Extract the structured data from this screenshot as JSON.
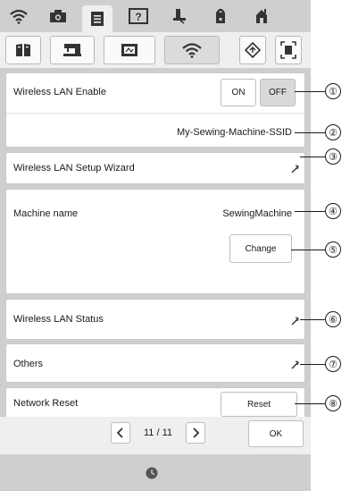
{
  "top_icons": [
    "wifi-icon",
    "camera-icon",
    "document-icon",
    "help-icon",
    "sewing-icon",
    "home-icon",
    "machine-icon"
  ],
  "tab_icons": [
    "book-icon",
    "machine-tab-icon",
    "embroidery-icon",
    "wifi-tab-icon",
    "reset-settings-icon",
    "screen-capture-icon"
  ],
  "rows": {
    "wlan_enable": {
      "label": "Wireless LAN Enable",
      "on_label": "ON",
      "off_label": "OFF",
      "state": "OFF"
    },
    "ssid": {
      "value": "My-Sewing-Machine-SSID"
    },
    "setup_wizard": {
      "label": "Wireless LAN Setup Wizard"
    },
    "machine_name": {
      "label": "Machine name",
      "value": "SewingMachine",
      "change_label": "Change"
    },
    "status": {
      "label": "Wireless LAN Status"
    },
    "others": {
      "label": "Others"
    },
    "network_reset": {
      "label": "Network Reset",
      "reset_label": "Reset"
    }
  },
  "pager": {
    "page_text": "11 / 11",
    "ok_label": "OK"
  },
  "callouts": [
    "①",
    "②",
    "③",
    "④",
    "⑤",
    "⑥",
    "⑦",
    "⑧"
  ],
  "colors": {
    "screen_bg": "#cfcfcf",
    "panel_bg": "#ffffff",
    "selected_btn": "#d9d9d9"
  }
}
